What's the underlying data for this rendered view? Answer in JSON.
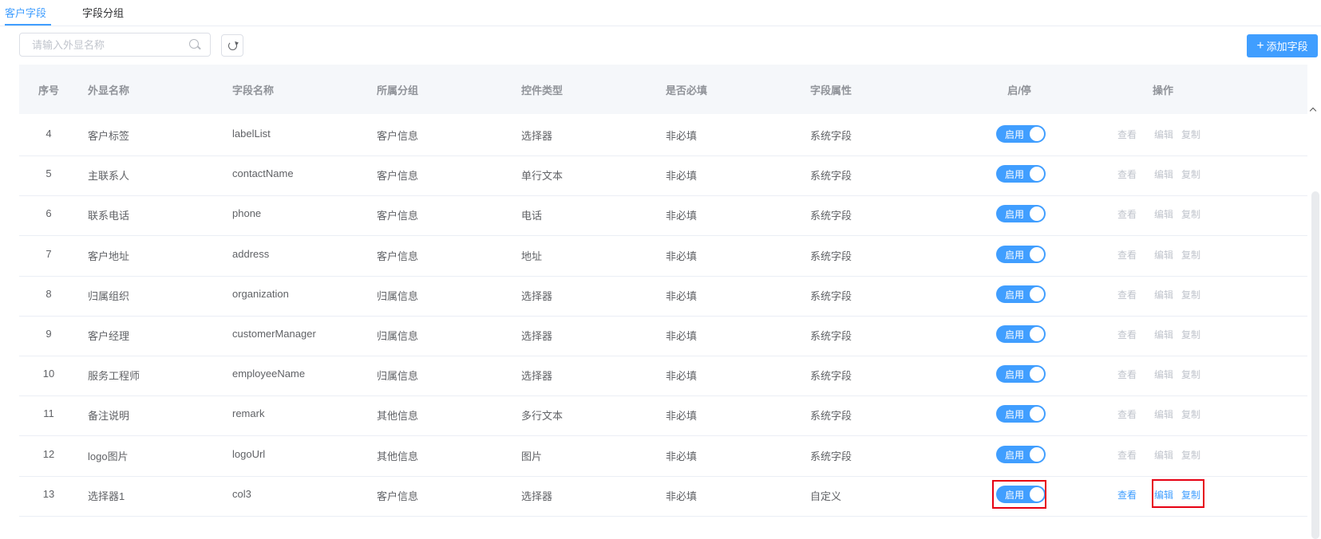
{
  "tabs": [
    "客户字段",
    "字段分组"
  ],
  "toolbar": {
    "search_placeholder": "请输入外显名称",
    "search_icon": "search-icon",
    "refresh_icon": "refresh-icon",
    "add_button_label": "添加字段",
    "add_icon": "plus-icon"
  },
  "columns": [
    "序号",
    "外显名称",
    "字段名称",
    "所属分组",
    "控件类型",
    "是否必填",
    "字段属性",
    "启/停",
    "操作"
  ],
  "ops": [
    "查看",
    "编辑",
    "复制"
  ],
  "rows": [
    {
      "no": "4",
      "display": "客户标签",
      "field": "labelList",
      "group": "客户信息",
      "control": "选择器",
      "required": "非必填",
      "attr": "系统字段",
      "status": "启用",
      "enabled": true,
      "ops_enabled": false
    },
    {
      "no": "5",
      "display": "主联系人",
      "field": "contactName",
      "group": "客户信息",
      "control": "单行文本",
      "required": "非必填",
      "attr": "系统字段",
      "status": "启用",
      "enabled": true,
      "ops_enabled": false
    },
    {
      "no": "6",
      "display": "联系电话",
      "field": "phone",
      "group": "客户信息",
      "control": "电话",
      "required": "非必填",
      "attr": "系统字段",
      "status": "启用",
      "enabled": true,
      "ops_enabled": false
    },
    {
      "no": "7",
      "display": "客户地址",
      "field": "address",
      "group": "客户信息",
      "control": "地址",
      "required": "非必填",
      "attr": "系统字段",
      "status": "启用",
      "enabled": true,
      "ops_enabled": false
    },
    {
      "no": "8",
      "display": "归属组织",
      "field": "organization",
      "group": "归属信息",
      "control": "选择器",
      "required": "非必填",
      "attr": "系统字段",
      "status": "启用",
      "enabled": true,
      "ops_enabled": false
    },
    {
      "no": "9",
      "display": "客户经理",
      "field": "customerManager",
      "group": "归属信息",
      "control": "选择器",
      "required": "非必填",
      "attr": "系统字段",
      "status": "启用",
      "enabled": true,
      "ops_enabled": false
    },
    {
      "no": "10",
      "display": "服务工程师",
      "field": "employeeName",
      "group": "归属信息",
      "control": "选择器",
      "required": "非必填",
      "attr": "系统字段",
      "status": "启用",
      "enabled": true,
      "ops_enabled": false
    },
    {
      "no": "11",
      "display": "备注说明",
      "field": "remark",
      "group": "其他信息",
      "control": "多行文本",
      "required": "非必填",
      "attr": "系统字段",
      "status": "启用",
      "enabled": true,
      "ops_enabled": false
    },
    {
      "no": "12",
      "display": "logo图片",
      "field": "logoUrl",
      "group": "其他信息",
      "control": "图片",
      "required": "非必填",
      "attr": "系统字段",
      "status": "启用",
      "enabled": true,
      "ops_enabled": false
    },
    {
      "no": "13",
      "display": "选择器1",
      "field": "col3",
      "group": "客户信息",
      "control": "选择器",
      "required": "非必填",
      "attr": "自定义",
      "status": "启用",
      "enabled": true,
      "ops_enabled": true
    }
  ],
  "colors": {
    "primary": "#409eff",
    "disabled": "#c0c4cc",
    "highlight": "#e60012"
  }
}
